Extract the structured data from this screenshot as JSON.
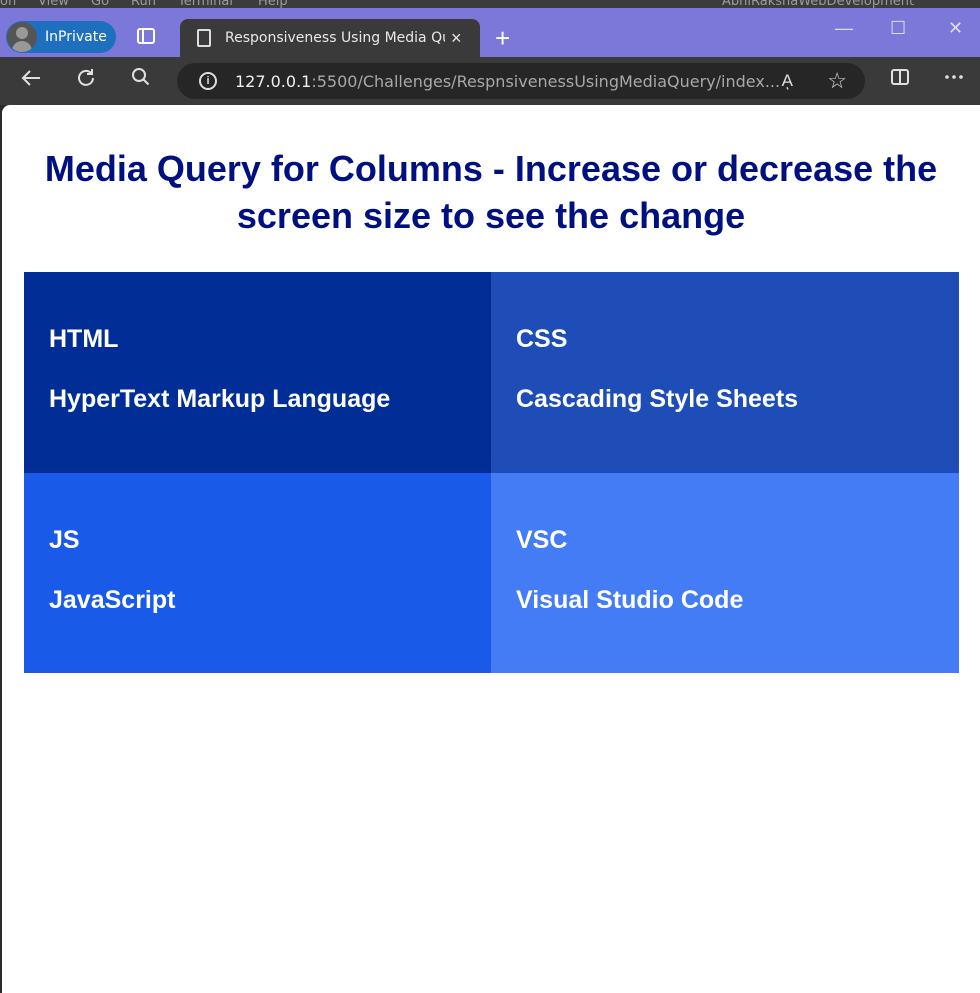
{
  "background_app": {
    "menu_items": [
      "on",
      "View",
      "Go",
      "Run",
      "Terminal",
      "Help"
    ],
    "search_text": "AbhiRakshaWebDevelopment"
  },
  "browser": {
    "profile_label": "InPrivate",
    "tab_title": "Responsiveness Using Media Query",
    "tab_close": "×",
    "new_tab": "+",
    "url_host": "127.0.0.1",
    "url_rest": ":5500/Challenges/RespnsivenessUsingMediaQuery/index...",
    "read_aloud": "Aͅ",
    "favorite": "☆",
    "window_minimize": "—",
    "window_maximize": "☐",
    "window_close": "✕"
  },
  "page": {
    "heading": "Media Query for Columns - Increase or decrease the screen size to see the change",
    "cells": [
      {
        "term": "HTML",
        "description": "HyperText Markup Language",
        "color": "#002d96"
      },
      {
        "term": "CSS",
        "description": "Cascading Style Sheets",
        "color": "#1f4db8"
      },
      {
        "term": "JS",
        "description": "JavaScript",
        "color": "#1a5ae8"
      },
      {
        "term": "VSC",
        "description": "Visual Studio Code",
        "color": "#447cf5"
      }
    ]
  }
}
